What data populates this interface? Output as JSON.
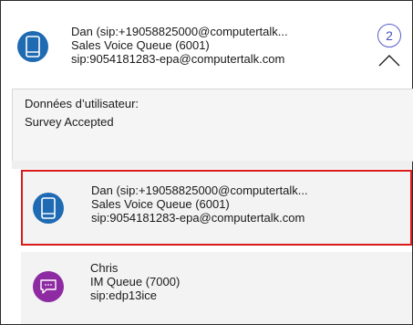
{
  "header": {
    "line1": "Dan    (sip:+19058825000@computertalk...",
    "line2": "Sales Voice Queue (6001)",
    "line3": "sip:9054181283-epa@computertalk.com",
    "count": "2",
    "avatar_icon": "mobile-phone-icon",
    "avatar_color": "#1f6bb3",
    "collapse_icon": "chevron-up-icon"
  },
  "user_data": {
    "label": "Données d’utilisateur:",
    "value": "Survey Accepted"
  },
  "cards": [
    {
      "line1": "Dan    (sip:+19058825000@computertalk...",
      "line2": "Sales Voice Queue (6001)",
      "line3": "sip:9054181283-epa@computertalk.com",
      "icon": "mobile-phone-icon",
      "color": "#1f6bb3",
      "selected": true,
      "highlight_color": "#d91b1b"
    },
    {
      "line1": "Chris",
      "line2": "IM Queue (7000)",
      "line3": "sip:edp13ice",
      "icon": "chat-bubble-icon",
      "color": "#8e2ba2",
      "selected": false
    }
  ]
}
